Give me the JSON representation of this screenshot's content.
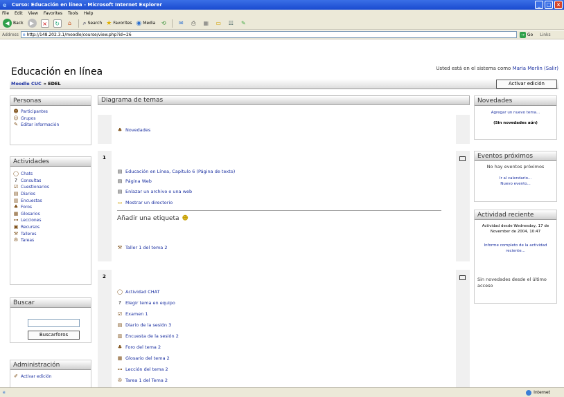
{
  "window": {
    "title": "Curso: Educación en línea - Microsoft Internet Explorer"
  },
  "menubar": [
    "File",
    "Edit",
    "View",
    "Favorites",
    "Tools",
    "Help"
  ],
  "toolbar": {
    "back": "Back",
    "search": "Search",
    "favorites": "Favorites",
    "media": "Media"
  },
  "address": {
    "label": "Address",
    "url": "http://148.202.3.1/moodle/course/view.php?id=26",
    "go": "Go",
    "links": "Links"
  },
  "site": {
    "title": "Educación en línea",
    "login_prefix": "Usted está en el sistema como",
    "user": "Maria Merlin",
    "logout": "(Salir)"
  },
  "navbar": {
    "home": "Moodle CUC",
    "sep": "» EDEL",
    "edit_button": "Activar edición"
  },
  "personas": {
    "title": "Personas",
    "items": [
      "Participantes",
      "Grupos",
      "Editar información"
    ]
  },
  "actividades": {
    "title": "Actividades",
    "items": [
      "Chats",
      "Consultas",
      "Cuestionarios",
      "Diarios",
      "Encuestas",
      "Foros",
      "Glosarios",
      "Lecciones",
      "Recursos",
      "Talleres",
      "Tareas"
    ]
  },
  "buscar": {
    "title": "Buscar",
    "button": "Buscarforos"
  },
  "admin": {
    "title": "Administración",
    "items": [
      "Activar edición"
    ]
  },
  "center": {
    "title": "Diagrama de temas",
    "section0": {
      "items": [
        "Novedades"
      ]
    },
    "section1": {
      "num": "1",
      "items": [
        "Educación en Línea, Capítulo 6 (Página de texto)",
        "Página Web",
        "Enlazar un archivo o una web",
        "Mostrar un directorio"
      ],
      "label": "Añadir una etiqueta",
      "extra": "Taller 1 del tema 2"
    },
    "section2": {
      "num": "2",
      "items": [
        "Actividad CHAT",
        "Elegir tema en equipo",
        "Examen 1",
        "Diario de la sesión 3",
        "Encuesta de la sesión 2",
        "Foro del tema 2",
        "Glosario del tema 2",
        "Lección del tema 2",
        "Tarea 1 del Tema 2"
      ]
    }
  },
  "novedades": {
    "title": "Novedades",
    "add": "Agregar un nuevo tema...",
    "none": "(Sin novedades aún)"
  },
  "eventos": {
    "title": "Eventos próximos",
    "none": "No hay eventos próximos",
    "calendar": "Ir al calendario...",
    "new": "Nuevo evento..."
  },
  "reciente": {
    "title": "Actividad reciente",
    "since": "Actividad desde Wednesday, 17 de November de 2004, 10:47",
    "report": "Informe completo de la actividad reciente...",
    "none": "Sin novedades desde el último acceso"
  },
  "status": {
    "zone": "Internet"
  }
}
